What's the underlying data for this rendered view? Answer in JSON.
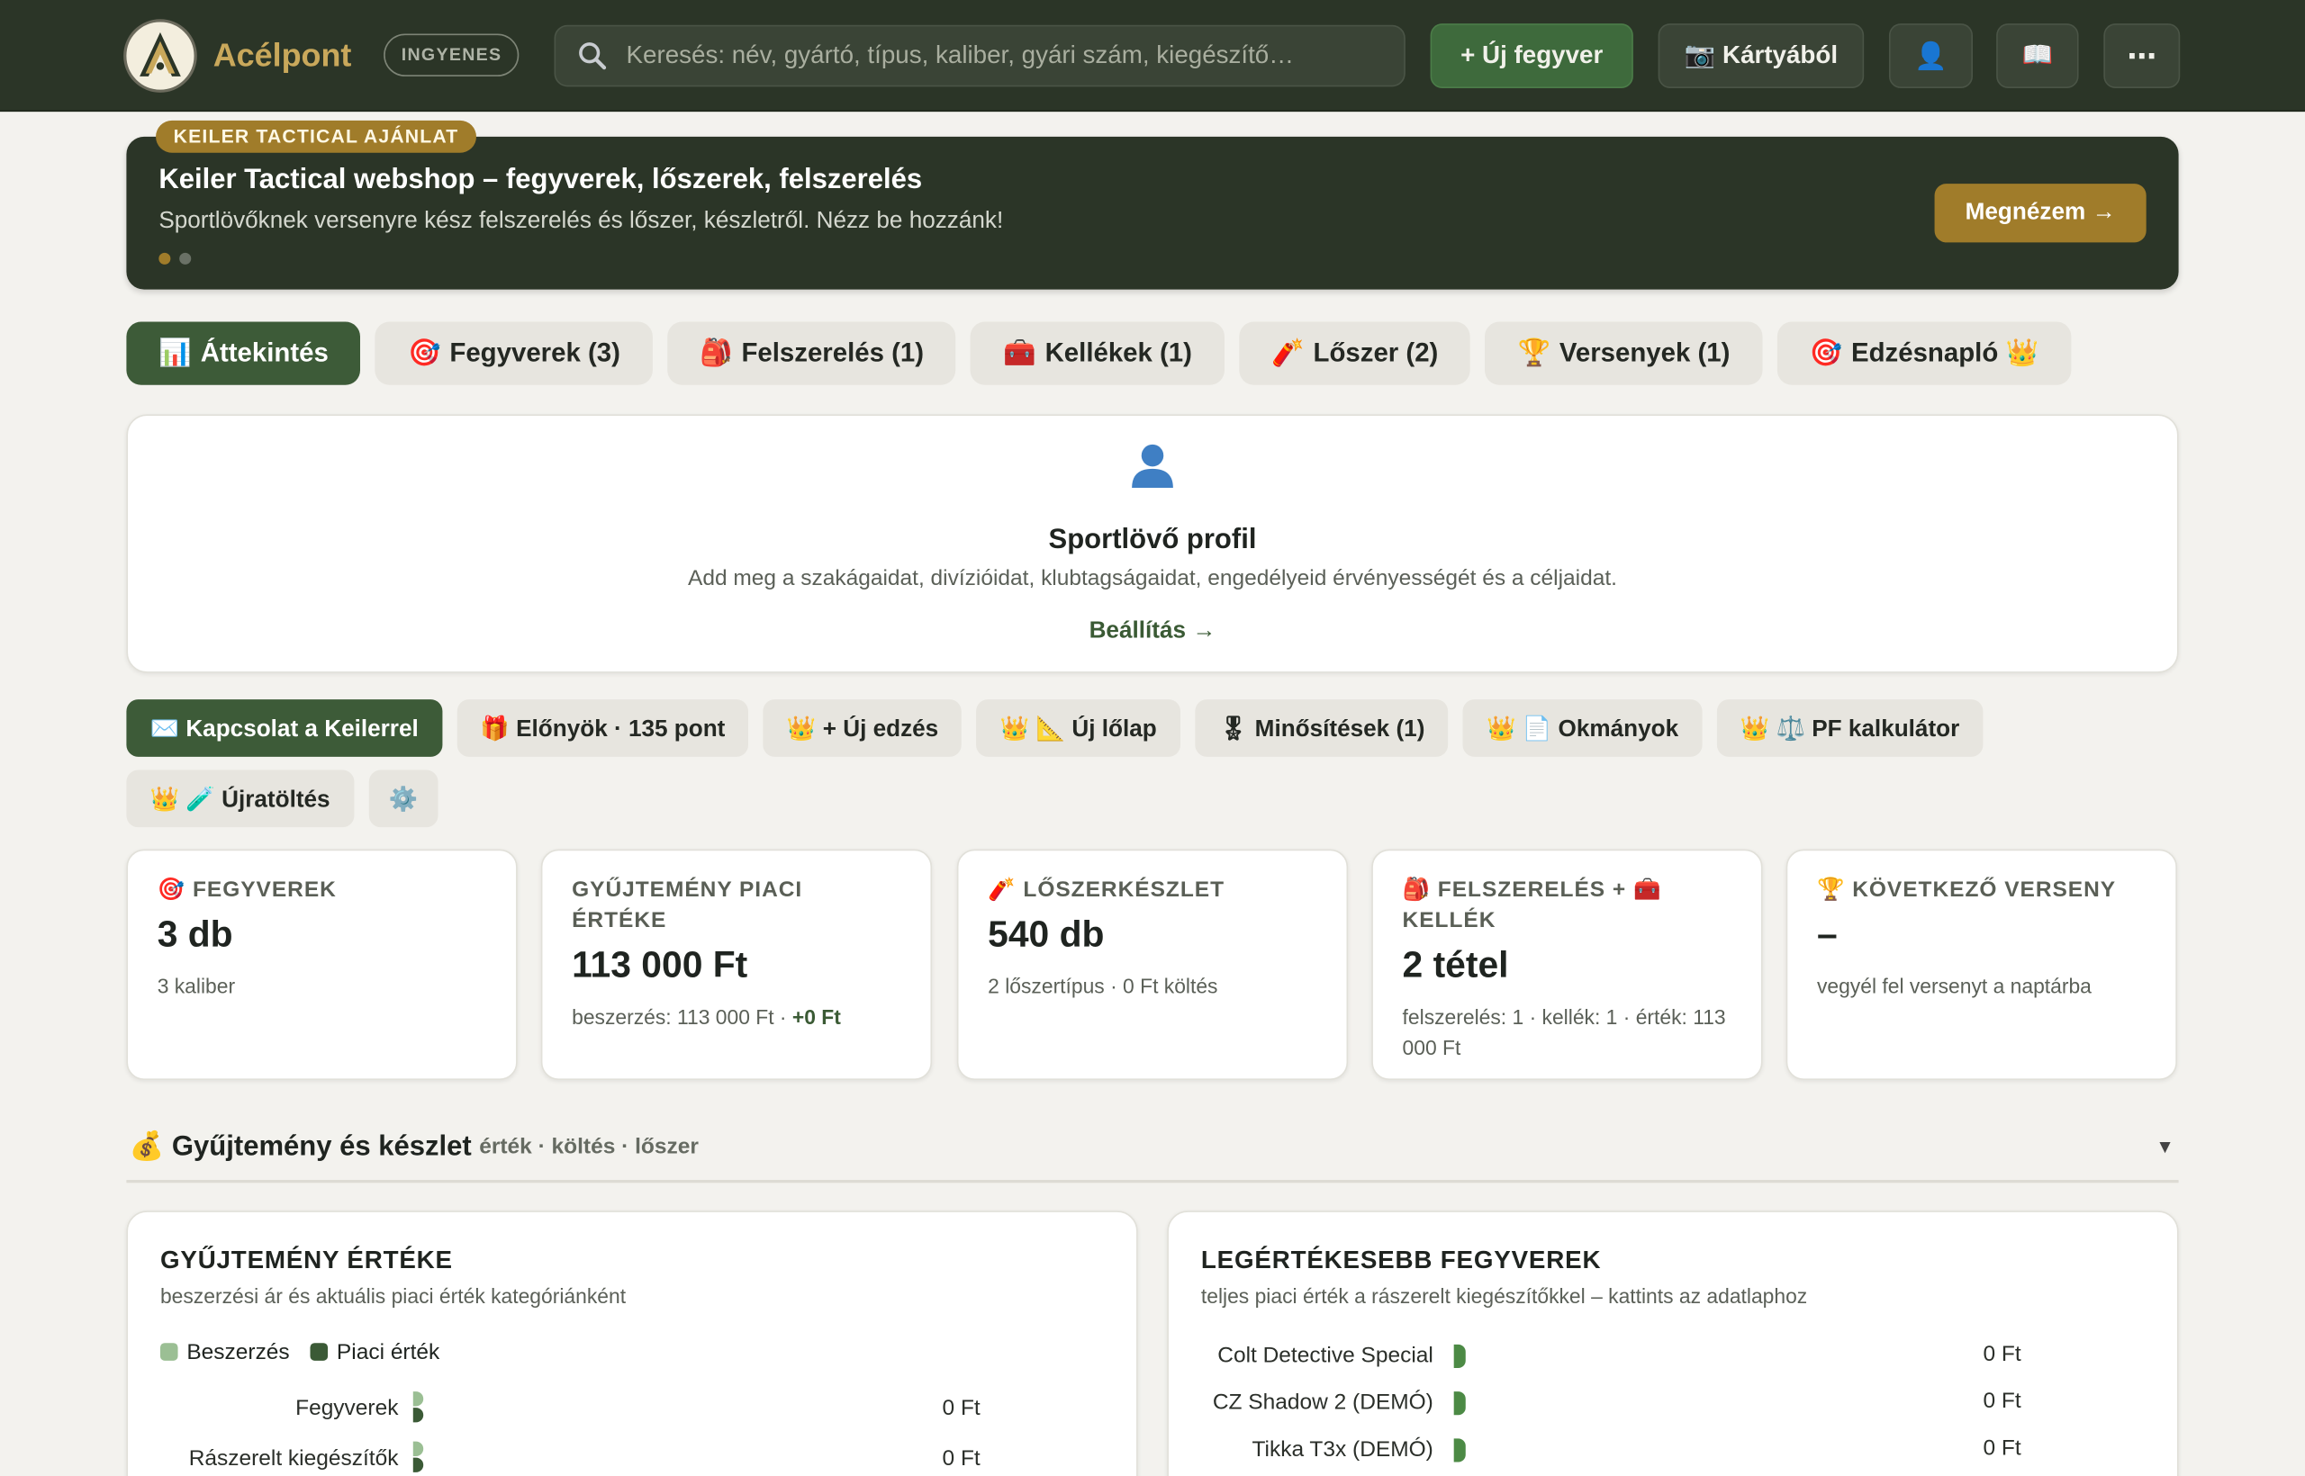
{
  "colors": {
    "topbar": "#2b3527",
    "accent_gold": "#a07c2a",
    "accent_green": "#3d5b38",
    "purchase": "#9bbf94",
    "market": "#3b5a36"
  },
  "header": {
    "app_name": "Acélpont",
    "plan_badge": "INGYENES",
    "search_placeholder": "Keresés: név, gyártó, típus, kaliber, gyári szám, kiegészítő…",
    "buttons": {
      "new_weapon": "+ Új fegyver",
      "from_card": "📷 Kártyából",
      "profile_icon": "👤",
      "guide_icon": "📖",
      "more_icon": "⋯"
    }
  },
  "promo": {
    "tag": "KEILER TACTICAL AJÁNLAT",
    "title": "Keiler Tactical webshop – fegyverek, lőszerek, felszerelés",
    "subtitle": "Sportlövőknek versenyre kész felszerelés és lőszer, készletről. Nézz be hozzánk!",
    "cta": "Megnézem →"
  },
  "tabs": [
    {
      "icon": "📊",
      "label": "Áttekintés"
    },
    {
      "icon": "🎯",
      "label": "Fegyverek (3)"
    },
    {
      "icon": "🎒",
      "label": "Felszerelés (1)"
    },
    {
      "icon": "🧰",
      "label": "Kellékek (1)"
    },
    {
      "icon": "🧨",
      "label": "Lőszer (2)"
    },
    {
      "icon": "🏆",
      "label": "Versenyek (1)"
    },
    {
      "icon": "🎯",
      "label": "Edzésnapló 👑"
    }
  ],
  "profile": {
    "icon": "👤",
    "title": "Sportlövő profil",
    "description": "Add meg a szakágaidat, divízióidat, klubtagságaidat, engedélyeid érvényességét és a céljaidat.",
    "link": "Beállítás →"
  },
  "actions": [
    {
      "label": "✉️ Kapcsolat a Keilerrel"
    },
    {
      "label": "🎁 Előnyök · 135 pont"
    },
    {
      "label": "👑 + Új edzés"
    },
    {
      "label": "👑 📐 Új lőlap"
    },
    {
      "label": "🎖 Minősítések (1)"
    },
    {
      "label": "👑 📄 Okmányok"
    },
    {
      "label": "👑 ⚖️ PF kalkulátor"
    },
    {
      "label": "👑 🧪 Újratöltés"
    },
    {
      "label": "⚙️"
    }
  ],
  "stats": [
    {
      "label": "🎯 FEGYVEREK",
      "value": "3 db",
      "sub": "3 kaliber"
    },
    {
      "label": "GYŰJTEMÉNY PIACI ÉRTÉKE",
      "value": "113 000 Ft",
      "sub": "beszerzés: 113 000 Ft · ",
      "sub_bold": "+0 Ft"
    },
    {
      "label": "🧨 LŐSZERKÉSZLET",
      "value": "540 db",
      "sub": "2 lőszertípus · 0 Ft költés"
    },
    {
      "label": "🎒 FELSZERELÉS + 🧰 KELLÉK",
      "value": "2 tétel",
      "sub": "felszerelés: 1 · kellék: 1 · érték: 113 000 Ft"
    },
    {
      "label": "🏆 KÖVETKEZŐ VERSENY",
      "value": "–",
      "sub": "vegyél fel versenyt a naptárba"
    }
  ],
  "section": {
    "title": "💰 Gyűjtemény és készlet",
    "subtitle": "érték · költés · lőszer",
    "chevron": "▾"
  },
  "value_panel": {
    "title": "GYŰJTEMÉNY ÉRTÉKE",
    "subtitle": "beszerzési ár és aktuális piaci érték kategóriánként",
    "legend": [
      "Beszerzés",
      "Piaci érték"
    ]
  },
  "top_panel": {
    "title": "LEGÉRTÉKESEBB FEGYVEREK",
    "subtitle": "teljes piaci érték a rászerelt kiegészítőkkel – kattints az adatlaphoz"
  },
  "chart_data": [
    {
      "type": "bar",
      "title": "GYŰJTEMÉNY ÉRTÉKE",
      "categories": [
        "Fegyverek",
        "Rászerelt kiegészítők"
      ],
      "series": [
        {
          "name": "Beszerzés",
          "values": [
            0,
            0
          ]
        },
        {
          "name": "Piaci érték",
          "values": [
            0,
            0
          ]
        }
      ],
      "value_labels": [
        "0 Ft",
        "0 Ft"
      ]
    },
    {
      "type": "bar",
      "title": "LEGÉRTÉKESEBB FEGYVEREK",
      "categories": [
        "Colt Detective Special",
        "CZ Shadow 2 (DEMÓ)",
        "Tikka T3x (DEMÓ)"
      ],
      "series": [
        {
          "values": [
            0,
            0,
            0
          ]
        }
      ],
      "value_labels": [
        "0 Ft",
        "0 Ft",
        "0 Ft"
      ]
    }
  ]
}
